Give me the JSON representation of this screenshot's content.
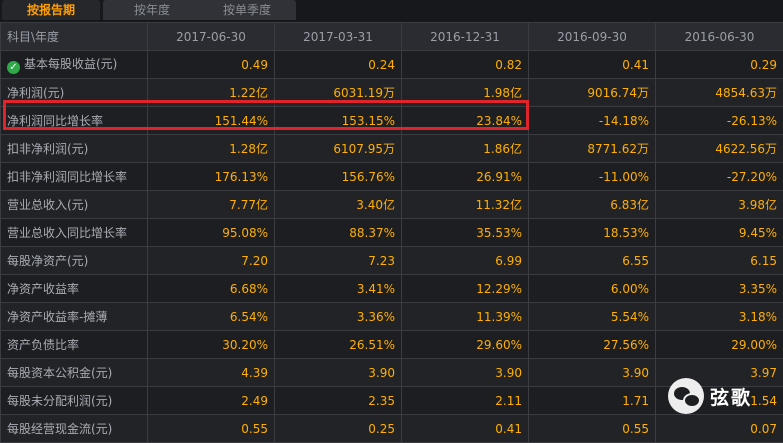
{
  "tabs": [
    {
      "label": "按报告期",
      "active": true
    },
    {
      "label": "按年度",
      "active": false
    },
    {
      "label": "按单季度",
      "active": false
    }
  ],
  "header": {
    "first": "科目\\年度",
    "periods": [
      "2017-06-30",
      "2017-03-31",
      "2016-12-31",
      "2016-09-30",
      "2016-06-30"
    ]
  },
  "rows": [
    {
      "label": "基本每股收益(元)",
      "values": [
        "0.49",
        "0.24",
        "0.82",
        "0.41",
        "0.29"
      ],
      "icon": "check-icon"
    },
    {
      "label": "净利润(元)",
      "values": [
        "1.22亿",
        "6031.19万",
        "1.98亿",
        "9016.74万",
        "4854.63万"
      ]
    },
    {
      "label": "净利润同比增长率",
      "values": [
        "151.44%",
        "153.15%",
        "23.84%",
        "-14.18%",
        "-26.13%"
      ],
      "highlight": true
    },
    {
      "label": "扣非净利润(元)",
      "values": [
        "1.28亿",
        "6107.95万",
        "1.86亿",
        "8771.62万",
        "4622.56万"
      ]
    },
    {
      "label": "扣非净利润同比增长率",
      "values": [
        "176.13%",
        "156.76%",
        "26.91%",
        "-11.00%",
        "-27.20%"
      ]
    },
    {
      "label": "营业总收入(元)",
      "values": [
        "7.77亿",
        "3.40亿",
        "11.32亿",
        "6.83亿",
        "3.98亿"
      ]
    },
    {
      "label": "营业总收入同比增长率",
      "values": [
        "95.08%",
        "88.37%",
        "35.53%",
        "18.53%",
        "9.45%"
      ]
    },
    {
      "label": "每股净资产(元)",
      "values": [
        "7.20",
        "7.23",
        "6.99",
        "6.55",
        "6.15"
      ]
    },
    {
      "label": "净资产收益率",
      "values": [
        "6.68%",
        "3.41%",
        "12.29%",
        "6.00%",
        "3.35%"
      ]
    },
    {
      "label": "净资产收益率-摊薄",
      "values": [
        "6.54%",
        "3.36%",
        "11.39%",
        "5.54%",
        "3.18%"
      ]
    },
    {
      "label": "资产负债比率",
      "values": [
        "30.20%",
        "26.51%",
        "29.60%",
        "27.56%",
        "29.00%"
      ]
    },
    {
      "label": "每股资本公积金(元)",
      "values": [
        "4.39",
        "3.90",
        "3.90",
        "3.90",
        "3.97"
      ]
    },
    {
      "label": "每股未分配利润(元)",
      "values": [
        "2.49",
        "2.35",
        "2.11",
        "1.71",
        "1.54"
      ]
    },
    {
      "label": "每股经营现金流(元)",
      "values": [
        "0.55",
        "0.25",
        "0.41",
        "0.55",
        "0.07"
      ]
    }
  ],
  "watermark": {
    "text": "弦歌",
    "icon": "wechat-icon"
  },
  "colors": {
    "value": "#ffb000",
    "highlight_border": "#e0242c",
    "active_tab": "#ff9e00"
  }
}
